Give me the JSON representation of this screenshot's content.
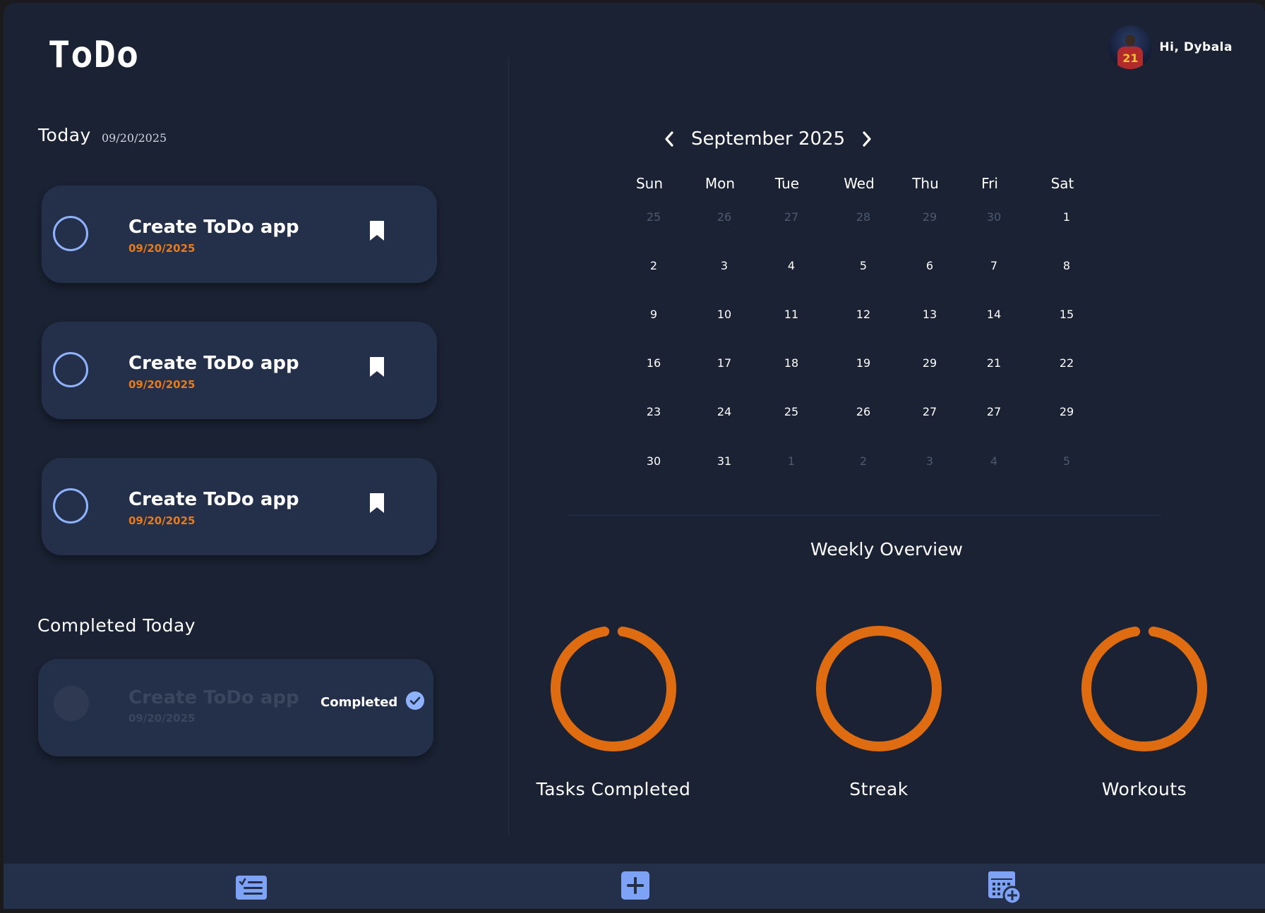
{
  "app": {
    "logo": "ToDo",
    "greeting": "Hi, Dybala",
    "avatar_number": "21"
  },
  "today": {
    "title": "Today",
    "date": "09/20/2025",
    "tasks": [
      {
        "title": "Create ToDo app",
        "date": "09/20/2025"
      },
      {
        "title": "Create ToDo app",
        "date": "09/20/2025"
      },
      {
        "title": "Create ToDo app",
        "date": "09/20/2025"
      }
    ]
  },
  "completed": {
    "title": "Completed Today",
    "tasks": [
      {
        "title": "Create ToDo app",
        "date": "09/20/2025",
        "status": "Completed"
      }
    ]
  },
  "calendar": {
    "month_label": "September 2025",
    "weekdays": [
      "Sun",
      "Mon",
      "Tue",
      "Wed",
      "Thu",
      "Fri",
      "Sat"
    ],
    "weeks": [
      [
        {
          "d": "25",
          "m": true
        },
        {
          "d": "26",
          "m": true
        },
        {
          "d": "27",
          "m": true
        },
        {
          "d": "28",
          "m": true
        },
        {
          "d": "29",
          "m": true
        },
        {
          "d": "30",
          "m": true
        },
        {
          "d": "1",
          "m": false
        }
      ],
      [
        {
          "d": "2",
          "m": false
        },
        {
          "d": "3",
          "m": false
        },
        {
          "d": "4",
          "m": false
        },
        {
          "d": "5",
          "m": false
        },
        {
          "d": "6",
          "m": false
        },
        {
          "d": "7",
          "m": false
        },
        {
          "d": "8",
          "m": false
        }
      ],
      [
        {
          "d": "9",
          "m": false
        },
        {
          "d": "10",
          "m": false
        },
        {
          "d": "11",
          "m": false
        },
        {
          "d": "12",
          "m": false
        },
        {
          "d": "13",
          "m": false
        },
        {
          "d": "14",
          "m": false
        },
        {
          "d": "15",
          "m": false
        }
      ],
      [
        {
          "d": "16",
          "m": false
        },
        {
          "d": "17",
          "m": false
        },
        {
          "d": "18",
          "m": false
        },
        {
          "d": "19",
          "m": false
        },
        {
          "d": "29",
          "m": false
        },
        {
          "d": "21",
          "m": false
        },
        {
          "d": "22",
          "m": false
        }
      ],
      [
        {
          "d": "23",
          "m": false
        },
        {
          "d": "24",
          "m": false
        },
        {
          "d": "25",
          "m": false
        },
        {
          "d": "26",
          "m": false
        },
        {
          "d": "27",
          "m": false
        },
        {
          "d": "27",
          "m": false
        },
        {
          "d": "29",
          "m": false
        }
      ],
      [
        {
          "d": "30",
          "m": false
        },
        {
          "d": "31",
          "m": false
        },
        {
          "d": "1",
          "m": true
        },
        {
          "d": "2",
          "m": true
        },
        {
          "d": "3",
          "m": true
        },
        {
          "d": "4",
          "m": true
        },
        {
          "d": "5",
          "m": true
        }
      ]
    ]
  },
  "weekly": {
    "title": "Weekly Overview",
    "rings": [
      {
        "label": "Tasks Completed",
        "progress": 0.95
      },
      {
        "label": "Streak",
        "progress": 1.0
      },
      {
        "label": "Workouts",
        "progress": 0.95
      }
    ],
    "ring_color": "#e06c12"
  },
  "nav": {
    "items": [
      "tasks-icon",
      "add-icon",
      "calendar-add-icon"
    ],
    "icon_color": "#7ea2f5"
  },
  "colors": {
    "background": "#1a2233",
    "card": "#243049",
    "accent_blue": "#8fb2ff",
    "date_orange": "#e97a1a"
  }
}
